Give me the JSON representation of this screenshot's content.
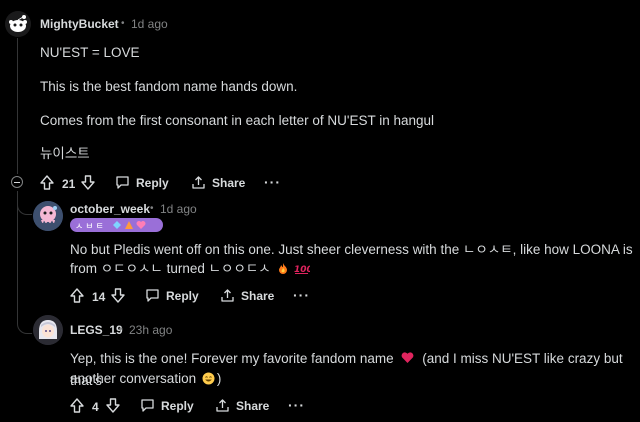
{
  "comments": [
    {
      "username": "MightyBucket",
      "separator": "•",
      "time": "1d ago",
      "paragraphs": [
        "NU'EST = LOVE",
        "This is the best fandom name hands down.",
        "Comes from the first consonant in each letter of NU'EST in hangul",
        "뉴이스트"
      ],
      "votes": "21",
      "reply_label": "Reply",
      "share_label": "Share",
      "more_label": "···"
    },
    {
      "username": "october_week",
      "separator": "•",
      "time": "1d ago",
      "flair_text": "ㅅㅂㅌ",
      "line1": "No but Pledis went off on this one. Just sheer cleverness with the ㄴㅇㅅㅌ, like how LOONA is",
      "line2_prefix": "from ㅇㄷㅇㅅㄴ turned ㄴㅇㅇㄷㅅ",
      "votes": "14",
      "reply_label": "Reply",
      "share_label": "Share",
      "more_label": "···"
    },
    {
      "username": "LEGS_19",
      "separator": "•",
      "time": "23h ago",
      "line1_prefix": "Yep, this is the one! Forever my favorite fandom name",
      "line1_suffix": "(and I miss NU'EST like crazy but that's",
      "line2_prefix": "another conversation",
      "line2_suffix": ")",
      "votes": "4",
      "reply_label": "Reply",
      "share_label": "Share",
      "more_label": "···"
    }
  ],
  "colors": {
    "background": "#000000",
    "text": "#d7dadc",
    "meta": "#818384",
    "thread_line": "#343536",
    "flair": "#9a6fd8",
    "heart": "#e0245e"
  },
  "icons": [
    "upvote-icon",
    "downvote-icon",
    "comment-icon",
    "share-icon",
    "more-icon",
    "collapse-icon",
    "fire-emoji",
    "hundred-emoji",
    "heart-emoji",
    "grin-emoji"
  ]
}
